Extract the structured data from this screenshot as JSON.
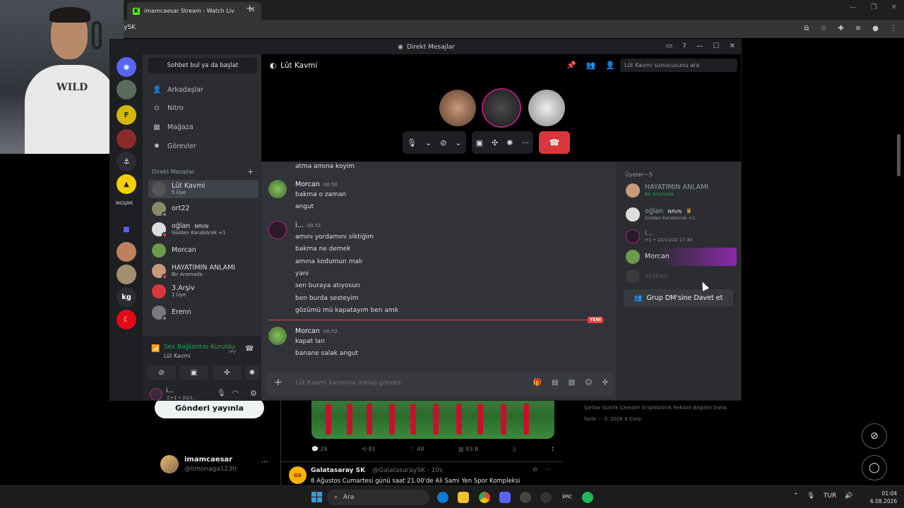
{
  "browser": {
    "tab_title": "imamcaesar Stream - Watch Liv",
    "favicon": "K",
    "url_fragment": "ySK"
  },
  "webcam": {
    "shirt_text": "WILD"
  },
  "discord": {
    "window_title": "Direkt Mesajlar",
    "dm_search": "Sohbet bul ya da başlat",
    "nav": [
      {
        "icon": "friends-icon",
        "label": "Arkadaşlar"
      },
      {
        "icon": "nitro-icon",
        "label": "Nitro"
      },
      {
        "icon": "shop-icon",
        "label": "Mağaza"
      },
      {
        "icon": "quests-icon",
        "label": "Görevler"
      }
    ],
    "guild_label": "İMÜŞİMİ",
    "guild_kg": "kg",
    "dm_header": "Direkt Mesajlar",
    "dms": [
      {
        "name": "Lût Kavmi",
        "sub": "5 Üye",
        "active": true
      },
      {
        "name": "ort22",
        "sub": ""
      },
      {
        "name": "oğlan",
        "badge": "NRVN",
        "sub": "Gülden Karaböcek +1"
      },
      {
        "name": "Morcan",
        "sub": ""
      },
      {
        "name": "HAYATIMIN ANLAMI",
        "sub": "Bir Aramada"
      },
      {
        "name": "3.Arşiv",
        "sub": "1 Üye"
      },
      {
        "name": "Erenn",
        "sub": ""
      }
    ],
    "voice": {
      "status": "Ses Bağlantısı Kuruldu",
      "channel": "Lût Kavmi"
    },
    "user": {
      "name": "i...",
      "sub": "♫+1 • 22/1..."
    },
    "channel_title": "Lût Kavmi",
    "server_search": "Lût Kavmi sunucusunu ara",
    "messages": {
      "top_line": "atma amına koyim",
      "m1": {
        "author": "Morcan",
        "time": "00:50",
        "lines": [
          "bakma o zaman",
          "angut"
        ]
      },
      "m2": {
        "author": "i...",
        "time": "00:51",
        "lines": [
          "amını yordamını siktiğim",
          "bakma ne demek",
          "amına kodumun malı",
          "yani",
          "sen buraya atıyosun",
          "ben burda sesteyim",
          "gözümü mü kapatayım ben amk"
        ]
      },
      "new_badge": "YENİ",
      "m3": {
        "author": "Morcan",
        "time": "00:52",
        "lines": [
          "kapat lan",
          "banane salak angut"
        ]
      }
    },
    "composer_placeholder": "Lût Kavmi kanalına mesaj gönder",
    "members_header": "Üyeler—5",
    "members": [
      {
        "name": "HAYATIMIN ANLAMI",
        "sub": "Bir Aramada"
      },
      {
        "name": "oğlan",
        "badge": "NRVN",
        "sub": "Gülden Karaböcek +1"
      },
      {
        "name": "i...",
        "sub": "+1 • 22/11/22 17:30"
      },
      {
        "name": "Morcan",
        "sub": ""
      },
      {
        "name": "atakan",
        "sub": ""
      }
    ],
    "invite_label": "Grup DM'sine Davet et"
  },
  "twitter": {
    "post_button": "Gönderi yayınla",
    "actions": [
      "28",
      "81",
      "48",
      "83 B"
    ],
    "profile_name": "imamcaesar",
    "profile_handle": "@limonaga123tr",
    "gs_name": "Galatasaray SK",
    "gs_handle": "@GalatasaraySK · 10s",
    "gs_text": "8 Ağustos Cumartesi günü saat 21.00'de Ali Sami Yen Spor Kompleksi",
    "footer": "Şartlar   Gizlilik   Çerezler   Erişilebilirlik   Reklam Bilgileri   Daha fazla ···   © 2026 X Corp."
  },
  "taskbar": {
    "search": "Ara",
    "lang": "TUR",
    "time": "01:04",
    "date": "6.08.2026"
  },
  "colors": {
    "discord_bg": "#313338",
    "accent_red": "#da373c",
    "online_green": "#23a55a"
  }
}
